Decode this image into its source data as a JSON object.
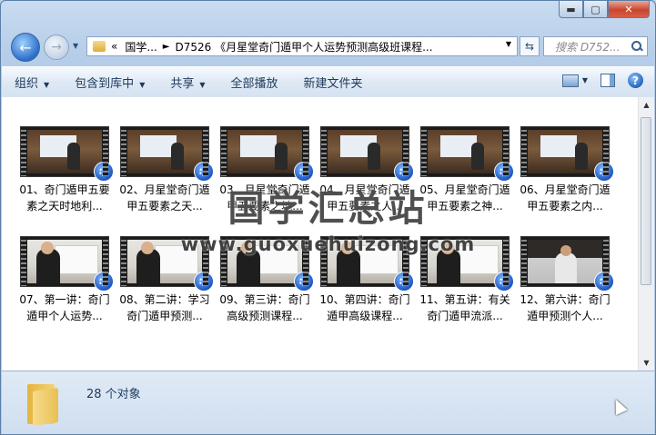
{
  "window": {
    "buttons": {
      "minimize": "▬",
      "maximize": "▢",
      "close": "✕"
    }
  },
  "nav": {
    "back_label": "←",
    "forward_label": "→",
    "address": {
      "chevron": "«",
      "crumbs": [
        "国学...",
        "D7526 《月星堂奇门遁甲个人运势预测高级班课程..."
      ]
    },
    "search_placeholder": "搜索 D752..."
  },
  "toolbar": {
    "items": [
      "组织",
      "包含到库中",
      "共享",
      "全部播放",
      "新建文件夹"
    ]
  },
  "files": [
    {
      "name": "01、奇门遁甲五要素之天时地利...",
      "scene": "a"
    },
    {
      "name": "02、月星堂奇门遁甲五要素之天...",
      "scene": "a"
    },
    {
      "name": "03、月星堂奇门遁甲五要素之地...",
      "scene": "a"
    },
    {
      "name": "04、月星堂奇门遁甲五要素之人...",
      "scene": "a"
    },
    {
      "name": "05、月星堂奇门遁甲五要素之神...",
      "scene": "a"
    },
    {
      "name": "06、月星堂奇门遁甲五要素之内...",
      "scene": "a"
    },
    {
      "name": "07、第一讲：奇门遁甲个人运势...",
      "scene": "b"
    },
    {
      "name": "08、第二讲：学习奇门遁甲预测...",
      "scene": "b"
    },
    {
      "name": "09、第三讲：奇门高级预测课程...",
      "scene": "b"
    },
    {
      "name": "10、第四讲：奇门遁甲高级课程...",
      "scene": "b"
    },
    {
      "name": "11、第五讲：有关奇门遁甲流派...",
      "scene": "b"
    },
    {
      "name": "12、第六讲：奇门遁甲预测个人...",
      "scene": "c"
    }
  ],
  "watermark": {
    "text": "国学汇总站",
    "url": "www.guoxuehuizong.com"
  },
  "status": {
    "count_text": "28 个对象"
  }
}
